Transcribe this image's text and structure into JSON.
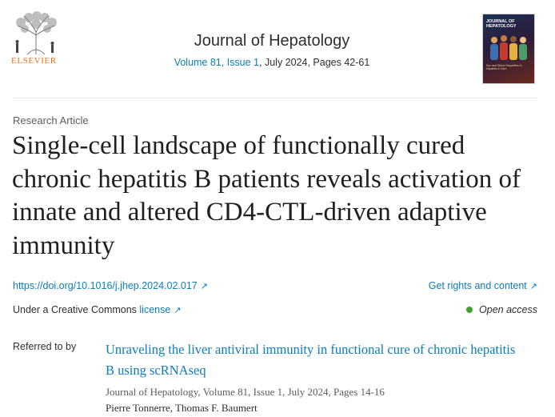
{
  "header": {
    "publisher": "ELSEVIER",
    "journal_name": "Journal of Hepatology",
    "volume_issue": "Volume 81, Issue 1",
    "issue_rest": ", July 2024, Pages 42-61",
    "cover_title": "JOURNAL OF HEPATOLOGY",
    "cover_subtitle": "Sex and Ethnic Disparities in Hepatitis & Care"
  },
  "article": {
    "type": "Research Article",
    "title": "Single-cell landscape of functionally cured chronic hepatitis B patients reveals activation of innate and altered CD4-CTL-driven adaptive immunity",
    "doi": "https://doi.org/10.1016/j.jhep.2024.02.017",
    "rights_label": "Get rights and content",
    "license_prefix": "Under a Creative Commons ",
    "license_link": "license",
    "access": "Open access",
    "arrow_glyph": "↗"
  },
  "referred": {
    "label": "Referred to by",
    "title": "Unraveling the liver antiviral immunity in functional cure of chronic hepatitis B using scRNAseq",
    "source": "Journal of Hepatology, Volume 81, Issue 1, July 2024, Pages 14-16",
    "authors": "Pierre Tonnerre, Thomas F. Baumert"
  },
  "colors": {
    "link": "#0c7dbb",
    "brand_orange": "#e9711c",
    "open_access_green": "#40a32c"
  }
}
